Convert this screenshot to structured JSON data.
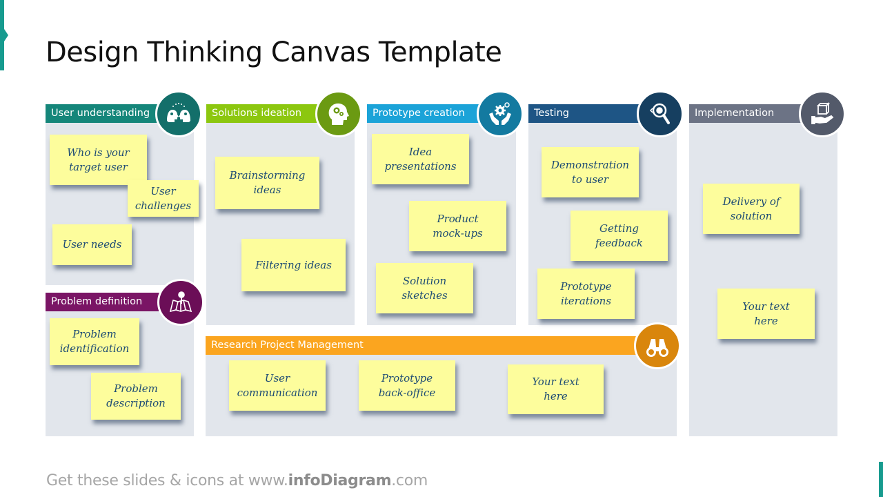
{
  "title": "Design Thinking Canvas Template",
  "colors": {
    "accent": "#179b8f",
    "note_bg": "#fdfd9c",
    "note_text": "#1d4b74",
    "panel_bg": "#e2e6ec"
  },
  "sections": {
    "user_understanding": {
      "label": "User understanding",
      "color": "#15867a",
      "icon_color": "#136f6a",
      "icon": "two-heads-icon",
      "notes": [
        "Who is your\ntarget user",
        "User\nchallenges",
        "User needs"
      ]
    },
    "problem_definition": {
      "label": "Problem definition",
      "color": "#7a1565",
      "icon_color": "#6b0e57",
      "icon": "map-pin-icon",
      "notes": [
        "Problem\nidentification",
        "Problem\ndescription"
      ]
    },
    "solutions_ideation": {
      "label": "Solutions ideation",
      "color": "#8cc70f",
      "icon_color": "#6b9a12",
      "icon": "head-gears-icon",
      "notes": [
        "Brainstorming\nideas",
        "Filtering ideas"
      ]
    },
    "prototype_creation": {
      "label": "Prototype creation",
      "color": "#1ba3d8",
      "icon_color": "#137aa0",
      "icon": "hands-gear-icon",
      "notes": [
        "Idea\npresentations",
        "Product\nmock-ups",
        "Solution\nsketches"
      ]
    },
    "testing": {
      "label": "Testing",
      "color": "#1e5585",
      "icon_color": "#163f60",
      "icon": "eye-magnifier-icon",
      "notes": [
        "Demonstration\nto user",
        "Getting\nfeedback",
        "Prototype\niterations"
      ]
    },
    "implementation": {
      "label": "Implementation",
      "color": "#6c7385",
      "icon_color": "#535a6a",
      "icon": "hand-box-icon",
      "notes": [
        "Delivery of\nsolution",
        "Your text\nhere"
      ]
    },
    "research_pm": {
      "label": "Research Project Management",
      "color": "#fba51f",
      "icon_color": "#d9860c",
      "icon": "binoculars-icon",
      "notes": [
        "User\ncommunication",
        "Prototype\nback-office",
        "Your text\nhere"
      ]
    }
  },
  "footer": {
    "prefix": "Get these slides & icons at www.",
    "brand": "infoDiagram",
    "suffix": ".com"
  }
}
